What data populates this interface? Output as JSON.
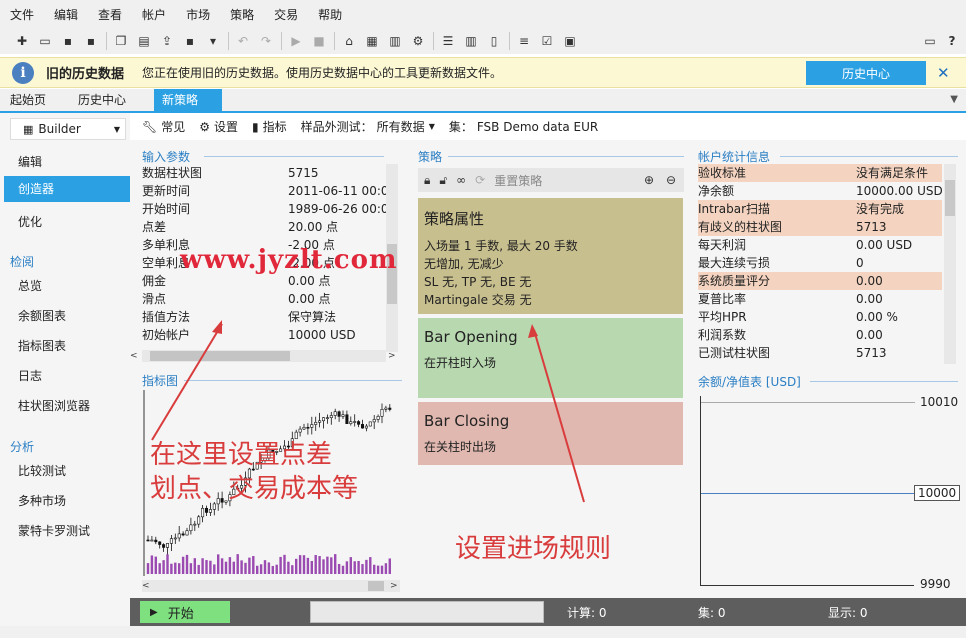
{
  "menu": [
    "文件",
    "编辑",
    "查看",
    "帐户",
    "市场",
    "策略",
    "交易",
    "帮助"
  ],
  "toolbar_icons": [
    "new-icon",
    "open-icon",
    "save-icon",
    "save-as-icon",
    "copy-icon",
    "paste-icon",
    "export-icon",
    "export-save-icon",
    "hat-icon",
    "undo-icon",
    "redo-icon",
    "play-icon",
    "stop-icon",
    "home-icon",
    "chart-icon",
    "columns-icon",
    "gear-icon",
    "list-icon",
    "book-icon",
    "doc-icon",
    "bars-icon",
    "check-icon",
    "briefcase-icon",
    "comment-icon",
    "help-icon"
  ],
  "infobar": {
    "title": "旧的历史数据",
    "message": "您正在使用旧的历史数据。使用历史数据中心的工具更新数据文件。",
    "button": "历史中心",
    "close": "✕"
  },
  "tabs": [
    {
      "label": "起始页",
      "active": false
    },
    {
      "label": "历史中心",
      "active": false
    },
    {
      "label": "新策略",
      "active": true
    }
  ],
  "sidebar": {
    "mode": "Builder",
    "items": [
      {
        "label": "编辑",
        "active": false
      },
      {
        "label": "创造器",
        "active": true
      },
      {
        "label": "优化",
        "active": false
      }
    ],
    "sections": [
      {
        "head": "检阅",
        "items": [
          "总览",
          "余额图表",
          "指标图表",
          "日志",
          "柱状图浏览器"
        ]
      },
      {
        "head": "分析",
        "items": [
          "比较测试",
          "多种市场",
          "蒙特卡罗测试"
        ]
      }
    ]
  },
  "subbar": {
    "common": "常见",
    "settings": "设置",
    "indicators": "指标",
    "oos_label": "样品外测试：",
    "oos_value": "所有数据",
    "set_label": "集：",
    "set_value": "FSB Demo data EUR"
  },
  "input_params": {
    "title": "输入参数",
    "rows": [
      {
        "k": "数据柱状图",
        "v": "5715"
      },
      {
        "k": "更新时间",
        "v": "2011-06-11 00:00"
      },
      {
        "k": "开始时间",
        "v": "1989-06-26 00:00"
      },
      {
        "k": "点差",
        "v": "20.00 点"
      },
      {
        "k": "多单利息",
        "v": "-2.00 点"
      },
      {
        "k": "空单利息",
        "v": "-2.00 点"
      },
      {
        "k": "佣金",
        "v": "0.00 点"
      },
      {
        "k": "滑点",
        "v": "0.00 点"
      },
      {
        "k": "插值方法",
        "v": "保守算法"
      },
      {
        "k": "初始帐户",
        "v": "10000 USD"
      }
    ]
  },
  "indicator_chart": {
    "title": "指标图"
  },
  "strategy": {
    "title": "策略",
    "reset": "重置策略",
    "props": {
      "title": "策略属性",
      "lines": [
        "入场量 1 手数, 最大 20 手数",
        "无增加, 无减少",
        "SL 无, TP 无, BE 无",
        "Martingale 交易 无"
      ],
      "color": "#c8bf8e"
    },
    "opening": {
      "title": "Bar Opening",
      "line": "在开柱时入场",
      "color": "#b8d8b0"
    },
    "closing": {
      "title": "Bar Closing",
      "line": "在关柱时出场",
      "color": "#e0b8b0"
    }
  },
  "account": {
    "title": "帐户统计信息",
    "rows": [
      {
        "k": "验收标准",
        "v": "没有满足条件",
        "hl": true
      },
      {
        "k": "净余额",
        "v": "10000.00 USD",
        "hl": false
      },
      {
        "k": "Intrabar扫描",
        "v": "没有完成",
        "hl": true
      },
      {
        "k": "有歧义的柱状图",
        "v": "5713",
        "hl": true
      },
      {
        "k": "每天利润",
        "v": "0.00 USD",
        "hl": false
      },
      {
        "k": "最大连续亏损",
        "v": "0",
        "hl": false
      },
      {
        "k": "系统质量评分",
        "v": "0.00",
        "hl": true
      },
      {
        "k": "夏普比率",
        "v": "0.00",
        "hl": false
      },
      {
        "k": "平均HPR",
        "v": "0.00 %",
        "hl": false
      },
      {
        "k": "利润系数",
        "v": "0.00",
        "hl": false
      },
      {
        "k": "已测试柱状图",
        "v": "5713",
        "hl": false
      }
    ]
  },
  "balance_chart": {
    "title": "余额/净值表 [USD]",
    "labels": {
      "top": "10010",
      "mid": "10000",
      "bottom": "9990"
    }
  },
  "statusbar": {
    "start": "开始",
    "calc": "计算: 0",
    "set": "集: 0",
    "show": "显示: 0"
  },
  "annotations": {
    "left": [
      "在这里设置点差",
      "划点、交易成本等"
    ],
    "right": "设置进场规则",
    "watermark": "www.jyzlt.com"
  },
  "colors": {
    "accent": "#2ba1e3",
    "section": "#2b7fc4",
    "annotation": "#d93c3c",
    "start_green": "#7ee07e",
    "highlight": "#f4d4c0",
    "candle_volume": "#9a4ab0"
  }
}
